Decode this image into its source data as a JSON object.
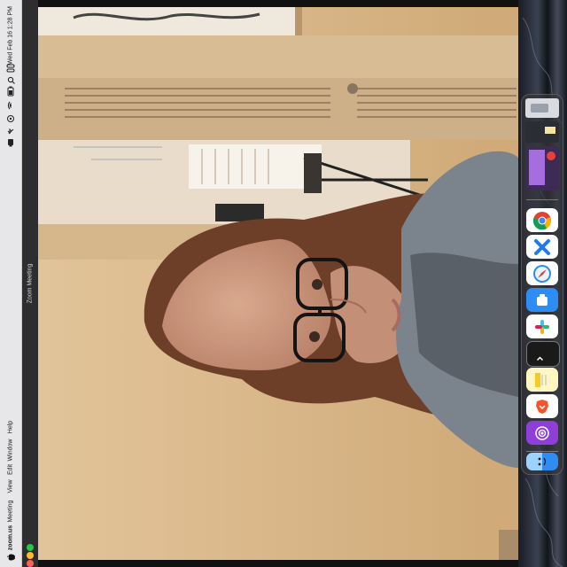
{
  "menubar": {
    "apple_icon": "apple-icon",
    "app_name": "zoom.us",
    "items": [
      "Meeting",
      "View",
      "Edit",
      "Window",
      "Help"
    ],
    "clock": "Wed Feb 16  1:28 PM",
    "status_icons": [
      "control-center-icon",
      "spotlight-search-icon",
      "battery-icon",
      "wifi-icon",
      "focus-icon",
      "bluetooth-icon",
      "camera-in-use-icon"
    ]
  },
  "window": {
    "title": "Zoom Meeting"
  },
  "dock": {
    "apps": [
      "chrome-icon",
      "xcode-icon",
      "safari-icon",
      "drive-icon",
      "slack-icon",
      "terminal-icon",
      "notes-icon",
      "brave-icon",
      "podcasts-icon"
    ],
    "finder": "finder-icon",
    "recent_thumbnails": [
      "document-thumbnail",
      "window-thumbnail",
      "video-thumbnail"
    ]
  },
  "colors": {
    "menubar_bg": "#e7e6e8",
    "titlebar_bg": "#2e2e31",
    "traffic_close": "#ff5f57",
    "traffic_minimize": "#febc2e",
    "traffic_zoom": "#28c840",
    "wall_beige": "#d8b98f"
  }
}
